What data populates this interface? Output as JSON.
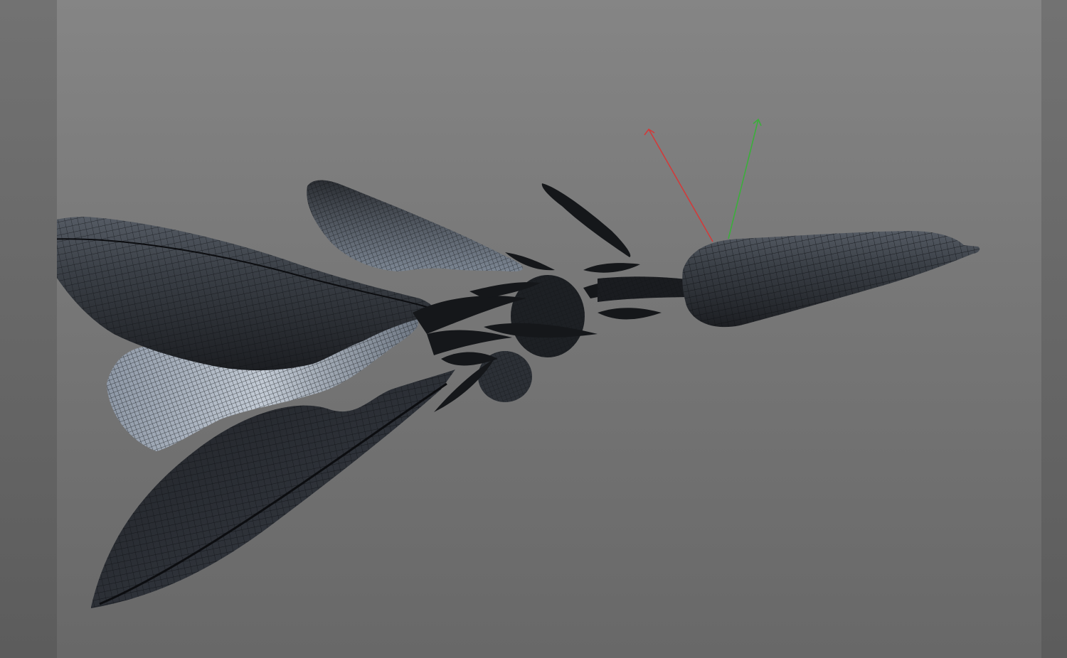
{
  "viewport": {
    "label": "3D viewport",
    "render_mode": "wireframe-on-shaded",
    "background_colors": [
      "#858585",
      "#686868"
    ]
  },
  "model": {
    "object": "wireframe-mesh",
    "shade_color": "#2f3237",
    "wire_color": "#111316",
    "highlight_color": "#9aa4b2"
  },
  "gizmo": {
    "axes": [
      {
        "axis": "x",
        "color": "#d23a3a"
      },
      {
        "axis": "y",
        "color": "#3cae3c"
      }
    ]
  }
}
